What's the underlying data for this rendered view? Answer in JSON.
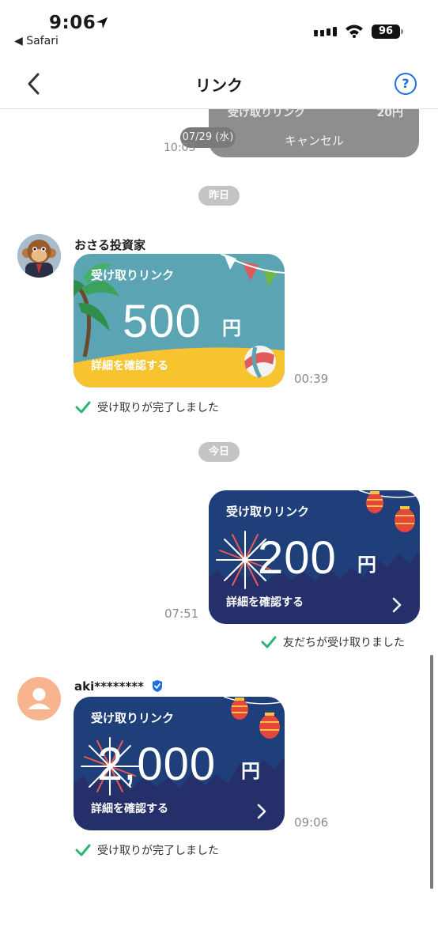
{
  "status_bar": {
    "time": "9:06",
    "back_app": "◀ Safari",
    "battery": "96"
  },
  "nav": {
    "title": "リンク",
    "help": "?"
  },
  "prev_message": {
    "label": "受け取りリンク",
    "amount": "20円",
    "cancel": "キャンセル",
    "date": "07/29 (水)",
    "time": "10:03"
  },
  "pills": {
    "yesterday": "昨日",
    "today": "今日"
  },
  "messages": [
    {
      "sender": "おさる投資家",
      "label": "受け取りリンク",
      "amount": "500",
      "yen": "円",
      "detail": "詳細を確認する",
      "time": "00:39",
      "status": "受け取りが完了しました"
    },
    {
      "label": "受け取りリンク",
      "amount": "200",
      "yen": "円",
      "detail": "詳細を確認する",
      "time": "07:51",
      "status": "友だちが受け取りました"
    },
    {
      "sender": "aki********",
      "label": "受け取りリンク",
      "amount": "2,000",
      "yen": "円",
      "detail": "詳細を確認する",
      "time": "09:06",
      "status": "受け取りが完了しました"
    }
  ],
  "colors": {
    "accent": "#1e6fe6",
    "check": "#2bb673",
    "night_card": "#1f3f7a",
    "beach_card": "#5aa4b4",
    "sand": "#f7c430"
  }
}
